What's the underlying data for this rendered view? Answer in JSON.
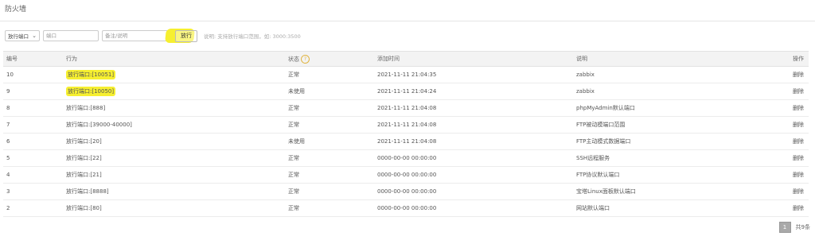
{
  "page": {
    "title": "防火墙"
  },
  "toolbar": {
    "select_value": "放行端口",
    "port_placeholder": "端口",
    "note_placeholder": "备注/说明",
    "allow_label": "放行",
    "hint": "说明: 支持放行端口范围，如: 3000:3500"
  },
  "table": {
    "headers": {
      "id": "编号",
      "action": "行为",
      "status": "状态",
      "added": "添加时间",
      "desc": "说明",
      "op": "操作"
    },
    "rows": [
      {
        "id": "10",
        "action": "放行端口:[10051]",
        "status": "正常",
        "time": "2021-11-11 21:04:35",
        "desc": "zabbix",
        "op": "删除",
        "highlight": true
      },
      {
        "id": "9",
        "action": "放行端口:[10050]",
        "status": "未使用",
        "time": "2021-11-11 21:04:24",
        "desc": "zabbix",
        "op": "删除",
        "highlight": true
      },
      {
        "id": "8",
        "action": "放行端口:[888]",
        "status": "正常",
        "time": "2021-11-11 21:04:08",
        "desc": "phpMyAdmin默认端口",
        "op": "删除"
      },
      {
        "id": "7",
        "action": "放行端口:[39000-40000]",
        "status": "正常",
        "time": "2021-11-11 21:04:08",
        "desc": "FTP被动模端口范围",
        "op": "删除"
      },
      {
        "id": "6",
        "action": "放行端口:[20]",
        "status": "未使用",
        "time": "2021-11-11 21:04:08",
        "desc": "FTP主动模式数据端口",
        "op": "删除"
      },
      {
        "id": "5",
        "action": "放行端口:[22]",
        "status": "正常",
        "time": "0000-00-00 00:00:00",
        "desc": "SSH远程服务",
        "op": "删除"
      },
      {
        "id": "4",
        "action": "放行端口:[21]",
        "status": "正常",
        "time": "0000-00-00 00:00:00",
        "desc": "FTP协议默认端口",
        "op": "删除"
      },
      {
        "id": "3",
        "action": "放行端口:[8888]",
        "status": "正常",
        "time": "0000-00-00 00:00:00",
        "desc": "宝塔Linux面板默认端口",
        "op": "删除"
      },
      {
        "id": "2",
        "action": "放行端口:[80]",
        "status": "正常",
        "time": "0000-00-00 00:00:00",
        "desc": "网站默认端口",
        "op": "删除"
      }
    ]
  },
  "pager": {
    "current": "1",
    "total": "共9条"
  },
  "colors": {
    "highlight": "#f6ef30",
    "header_bg": "#f3f3f3",
    "help_icon": "#e0b440"
  }
}
